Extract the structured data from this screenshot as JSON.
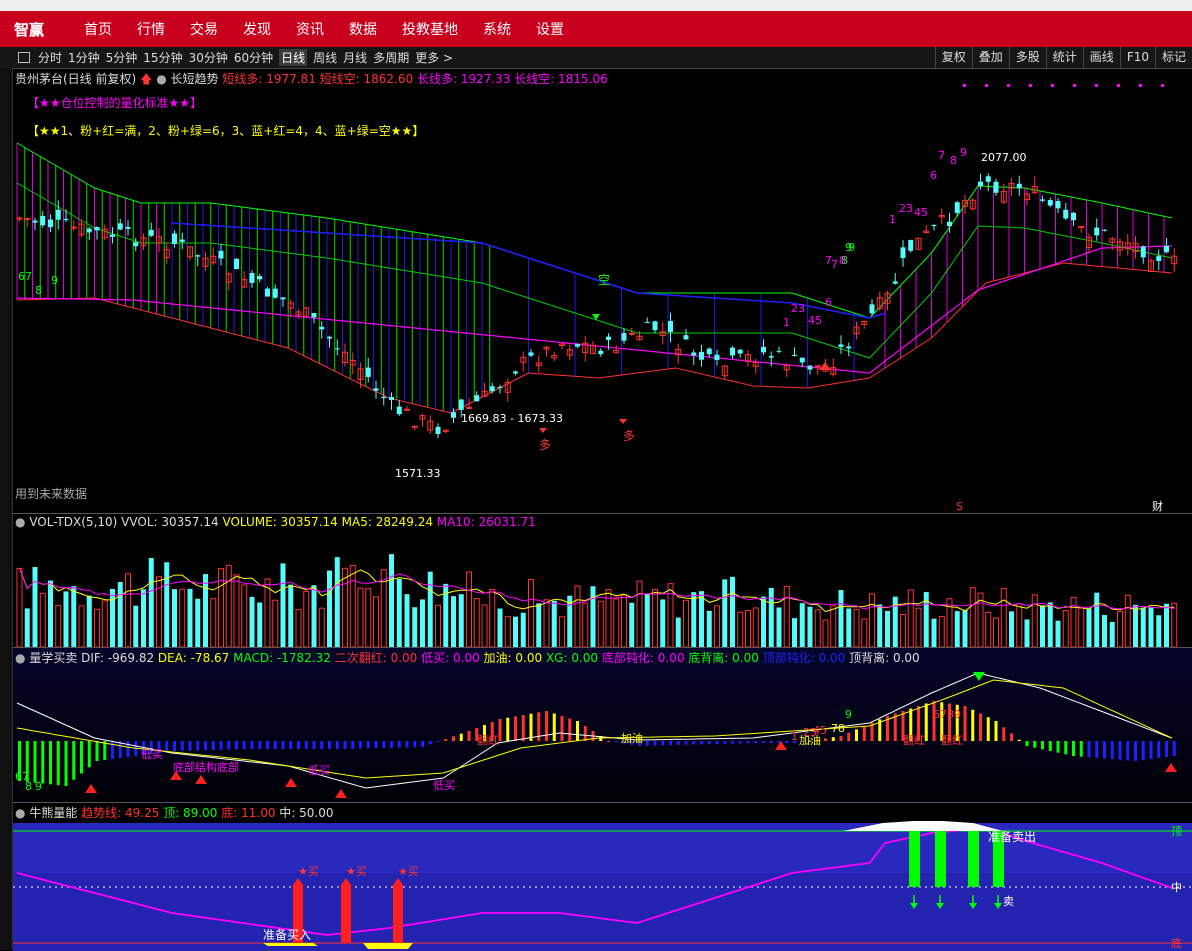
{
  "menu": {
    "logo": "智赢",
    "items": [
      "首页",
      "行情",
      "交易",
      "发现",
      "资讯",
      "数据",
      "投教基地",
      "系统",
      "设置"
    ]
  },
  "periods": {
    "items": [
      "分时",
      "1分钟",
      "5分钟",
      "15分钟",
      "30分钟",
      "60分钟",
      "日线",
      "周线",
      "月线",
      "多周期",
      "更多 >"
    ],
    "active": "日线",
    "right": [
      "复权",
      "叠加",
      "多股",
      "统计",
      "画线",
      "F10",
      "标记"
    ]
  },
  "main_chart": {
    "stock": "贵州茅台(日线 前复权)",
    "indicator": "长短趋势",
    "short_long": "短线多: 1977.81",
    "short_short": "短线空: 1862.60",
    "long_long": "长线多: 1927.33",
    "long_short": "长线空: 1815.06",
    "note1": "【★★仓位控制的量化标准★★】",
    "note2": "【★★1、粉+红=满，2、粉+绿=6，3、蓝+红=4，4、蓝+绿=空★★】",
    "high_label": "2077.00",
    "low_label": "1571.33",
    "range_label": "1669.83 - 1673.33",
    "kong_label": "空",
    "duo_label": "多",
    "future_label": "用到未来数据",
    "s_marker": "S",
    "cai_marker": "财",
    "seq_labels": [
      "67",
      "8",
      "9",
      "7",
      "8",
      "9",
      "1",
      "23",
      "45",
      "6",
      "7",
      "8",
      "9",
      "1",
      "23",
      "45",
      "6",
      "7",
      "8",
      "9"
    ]
  },
  "vol_panel": {
    "name": "VOL-TDX(5,10)",
    "vvol": "VVOL: 30357.14",
    "volume": "VOLUME: 30357.14",
    "ma5": "MA5: 28249.24",
    "ma10": "MA10: 26031.71"
  },
  "macd_panel": {
    "name": "量学买卖",
    "dif": "DIF: -969.82",
    "dea": "DEA: -78.67",
    "macd": "MACD: -1782.32",
    "erci": "二次翻红: 0.00",
    "dimai": "低买: 0.00",
    "jiayou": "加油: 0.00",
    "xg": "XG: 0.00",
    "dibu_dh": "底部钝化: 0.00",
    "dibei": "底背离: 0.00",
    "dingbu_dh": "顶部钝化: 0.00",
    "dingbei": "顶背离: 0.00",
    "annots": [
      "低买",
      "底部结构底部",
      "低买",
      "低买",
      "翻红",
      "加油",
      "加油",
      "翻红",
      "翻红"
    ],
    "seq": [
      "67",
      "8",
      "9",
      "78",
      "9",
      "1",
      "23",
      "45",
      "6789"
    ]
  },
  "bull_panel": {
    "name": "牛熊量能",
    "trend": "趋势线: 49.25",
    "top": "顶: 89.00",
    "bottom": "底: 11.00",
    "mid": "中: 50.00",
    "buy_ready": "准备买入",
    "sell_ready": "准备卖出",
    "buy": "★买",
    "sell": "卖",
    "lbl_top": "顶",
    "lbl_mid": "中",
    "lbl_bottom": "底"
  },
  "colors": {
    "menu_bg": "#c8001e",
    "up": "#ff3232",
    "down": "#54fcfc",
    "pink": "#ff00ff",
    "blue": "#2020ff",
    "green": "#00ff00",
    "yellow": "#ffff00"
  }
}
